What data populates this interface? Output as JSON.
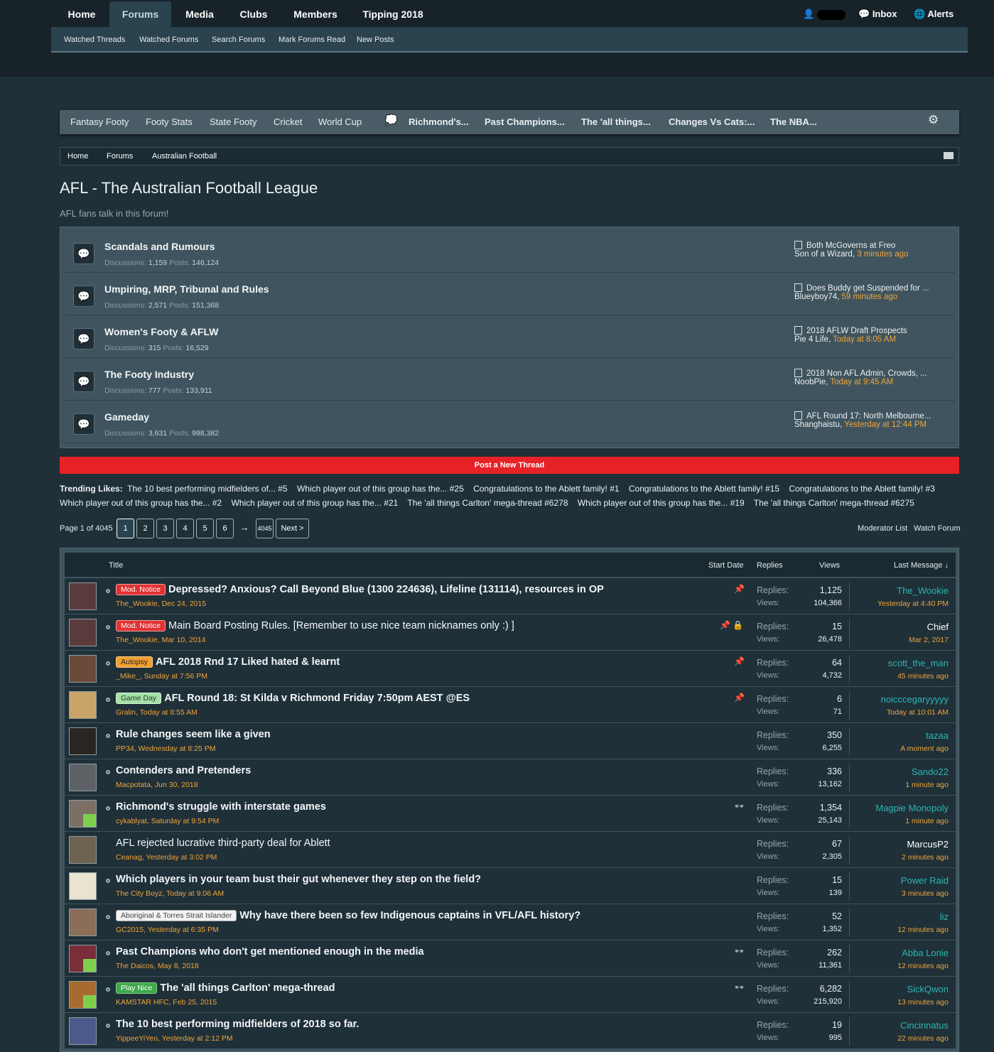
{
  "topnav": {
    "tabs": [
      "Home",
      "Forums",
      "Media",
      "Clubs",
      "Members",
      "Tipping 2018"
    ],
    "active": "Forums",
    "inbox": "Inbox",
    "alerts": "Alerts"
  },
  "subnav": [
    "Watched Threads",
    "Watched Forums",
    "Search Forums",
    "Mark Forums Read",
    "New Posts"
  ],
  "quickbar": {
    "links": [
      "Fantasy Footy",
      "Footy Stats",
      "State Footy",
      "Cricket",
      "World Cup"
    ],
    "threads": [
      "Richmond's...",
      "Past Champions...",
      "The 'all things...",
      "Changes Vs Cats:...",
      "The NBA..."
    ]
  },
  "breadcrumb": [
    "Home",
    "Forums",
    "Australian Football"
  ],
  "page": {
    "title": "AFL - The Australian Football League",
    "description": "AFL fans talk in this forum!"
  },
  "labels": {
    "discussions": "Discussions:",
    "posts": "Posts:",
    "replies": "Replies:",
    "views": "Views:"
  },
  "forums": [
    {
      "title": "Scandals and Rumours",
      "discussions": "1,159",
      "posts": "146,124",
      "last_title": "Both McGoverns at Freo",
      "last_user": "Son of a Wizard,",
      "last_time": "3 minutes ago"
    },
    {
      "title": "Umpiring, MRP, Tribunal and Rules",
      "discussions": "2,571",
      "posts": "151,368",
      "last_title": "Does Buddy get Suspended for ...",
      "last_user": "Blueyboy74,",
      "last_time": "59 minutes ago"
    },
    {
      "title": "Women's Footy & AFLW",
      "discussions": "315",
      "posts": "16,529",
      "last_title": "2018 AFLW Draft Prospects",
      "last_user": "Pie 4 Life,",
      "last_time": "Today at 8:05 AM"
    },
    {
      "title": "The Footy Industry",
      "discussions": "777",
      "posts": "133,911",
      "last_title": "2018 Non AFL Admin, Crowds, ...",
      "last_user": "NoobPie,",
      "last_time": "Today at 9:45 AM"
    },
    {
      "title": "Gameday",
      "discussions": "3,631",
      "posts": "998,382",
      "last_title": "AFL Round 17: North Melbourne...",
      "last_user": "Shanghaistu,",
      "last_time": "Yesterday at 12:44 PM"
    }
  ],
  "post_button": "Post a New Thread",
  "trending": {
    "label": "Trending Likes:",
    "items": [
      "The 10 best performing midfielders of... #5",
      "Which player out of this group has the... #25",
      "Congratulations to the Ablett family! #1",
      "Congratulations to the Ablett family! #15",
      "Congratulations to the Ablett family! #3",
      "Which player out of this group has the... #2",
      "Which player out of this group has the... #21",
      "The 'all things Carlton' mega-thread #6278",
      "Which player out of this group has the... #19",
      "The 'all things Carlton' mega-thread #6275"
    ]
  },
  "pager": {
    "label": "Page 1 of 4045",
    "pages": [
      "1",
      "2",
      "3",
      "4",
      "5",
      "6"
    ],
    "arrow": "→",
    "last": "4045",
    "next": "Next >",
    "moderator": "Moderator List",
    "watch": "Watch Forum"
  },
  "thead": {
    "title": "Title",
    "start": "Start Date",
    "replies": "Replies",
    "views": "Views",
    "last": "Last Message ↓"
  },
  "threads": [
    {
      "prefix": "Mod. Notice",
      "ptype": "mod",
      "title": "Depressed? Anxious? Call Beyond Blue (1300 224636), Lifeline (131114), resources in OP",
      "bold": true,
      "meta": "The_Wookie, Dec 24, 2015",
      "replies": "1,125",
      "views": "104,366",
      "last_user": "The_Wookie",
      "last_time": "Yesterday at 4:40 PM",
      "ucolor": "c",
      "icons": "📌"
    },
    {
      "prefix": "Mod. Notice",
      "ptype": "mod",
      "title": "Main Board Posting Rules. [Remember to use nice team nicknames only :) ]",
      "bold": false,
      "meta": "The_Wookie, Mar 10, 2014",
      "replies": "15",
      "views": "26,478",
      "last_user": "Chief",
      "last_time": "Mar 2, 2017",
      "ucolor": "w",
      "icons": "📌 🔒"
    },
    {
      "prefix": "Autopsy",
      "ptype": "autopsy",
      "title": "AFL 2018 Rnd 17 Liked hated & learnt",
      "bold": true,
      "meta": "_Mike_, Sunday at 7:56 PM",
      "replies": "64",
      "views": "4,732",
      "last_user": "scott_the_man",
      "last_time": "45 minutes ago",
      "ucolor": "c",
      "icons": "📌"
    },
    {
      "prefix": "Game Day",
      "ptype": "gameday",
      "title": "AFL Round 18: St Kilda v Richmond Friday 7:50pm AEST @ES",
      "bold": true,
      "meta": "Gralin, Today at 8:55 AM",
      "replies": "6",
      "views": "71",
      "last_user": "noicccegaryyyyy",
      "last_time": "Today at 10:01 AM",
      "ucolor": "c",
      "icons": "📌"
    },
    {
      "prefix": "",
      "ptype": "",
      "title": "Rule changes seem like a given",
      "bold": true,
      "meta": "PP34, Wednesday at 8:25 PM",
      "replies": "350",
      "views": "6,255",
      "last_user": "tazaa",
      "last_time": "A moment ago",
      "ucolor": "c",
      "icons": ""
    },
    {
      "prefix": "",
      "ptype": "",
      "title": "Contenders and Pretenders",
      "bold": true,
      "meta": "Macpotata, Jun 30, 2018",
      "replies": "336",
      "views": "13,162",
      "last_user": "Sando22",
      "last_time": "1 minute ago",
      "ucolor": "c",
      "icons": ""
    },
    {
      "prefix": "",
      "ptype": "",
      "title": "Richmond's struggle with interstate games",
      "bold": true,
      "meta": "cykablyat, Saturday at 9:54 PM",
      "replies": "1,354",
      "views": "25,143",
      "last_user": "Magpie Monopoly",
      "last_time": "1 minute ago",
      "ucolor": "c",
      "icons": "👓"
    },
    {
      "prefix": "",
      "ptype": "",
      "title": "AFL rejected lucrative third-party deal for Ablett",
      "bold": false,
      "meta": "Ceanag, Yesterday at 3:02 PM",
      "replies": "67",
      "views": "2,305",
      "last_user": "MarcusP2",
      "last_time": "2 minutes ago",
      "ucolor": "w",
      "icons": ""
    },
    {
      "prefix": "",
      "ptype": "",
      "title": "Which players in your team bust their gut whenever they step on the field?",
      "bold": true,
      "meta": "The City Boyz, Today at 9:06 AM",
      "replies": "15",
      "views": "139",
      "last_user": "Power Raid",
      "last_time": "3 minutes ago",
      "ucolor": "c",
      "icons": ""
    },
    {
      "prefix": "Aboriginal & Torres Strait Islander",
      "ptype": "indig",
      "title": "Why have there been so few Indigenous captains in VFL/AFL history?",
      "bold": true,
      "meta": "GC2015, Yesterday at 6:35 PM",
      "replies": "52",
      "views": "1,352",
      "last_user": "liz",
      "last_time": "12 minutes ago",
      "ucolor": "c",
      "icons": ""
    },
    {
      "prefix": "",
      "ptype": "",
      "title": "Past Champions who don't get mentioned enough in the media",
      "bold": true,
      "meta": "The Daicos, May 8, 2018",
      "replies": "262",
      "views": "11,361",
      "last_user": "Abba Lonie",
      "last_time": "12 minutes ago",
      "ucolor": "c",
      "icons": "👓"
    },
    {
      "prefix": "Play Nice",
      "ptype": "play",
      "title": "The 'all things Carlton' mega-thread",
      "bold": true,
      "meta": "KAMSTAR HFC, Feb 25, 2015",
      "replies": "6,282",
      "views": "215,920",
      "last_user": "SickQwon",
      "last_time": "13 minutes ago",
      "ucolor": "c",
      "icons": "👓"
    },
    {
      "prefix": "",
      "ptype": "",
      "title": "The 10 best performing midfielders of 2018 so far.",
      "bold": true,
      "meta": "YippeeYiYeo, Yesterday at 2:12 PM",
      "replies": "19",
      "views": "995",
      "last_user": "Cincinnatus",
      "last_time": "22 minutes ago",
      "ucolor": "c",
      "icons": ""
    }
  ],
  "colors": {
    "accent": "#f0a43a",
    "username": "#2cb5b5",
    "post_button": "#e62226"
  }
}
